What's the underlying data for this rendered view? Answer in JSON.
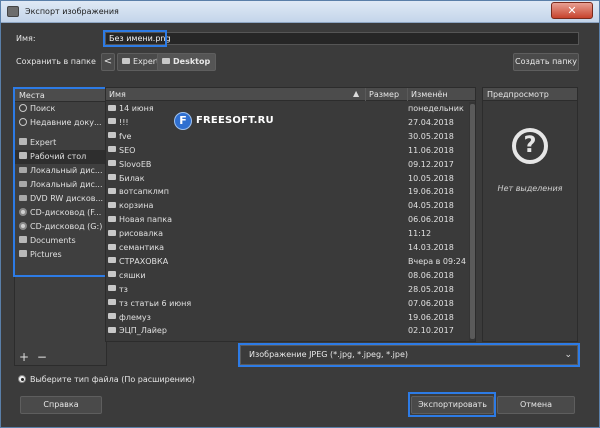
{
  "window": {
    "title": "Экспорт изображения",
    "close_glyph": "✕"
  },
  "name_label": "Имя:",
  "name_value": "Без имени.png",
  "folder_label": "Сохранить в папке",
  "breadcrumb": {
    "back_glyph": "<",
    "items": [
      "Expert",
      "Desktop"
    ]
  },
  "create_folder_label": "Создать папку",
  "places": {
    "header": "Места",
    "items": [
      {
        "label": "Поиск",
        "icon": "search-icon"
      },
      {
        "label": "Недавние доку...",
        "icon": "clock-icon"
      },
      {
        "label": "Expert",
        "icon": "folder-icon"
      },
      {
        "label": "Рабочий стол",
        "icon": "folder-icon"
      },
      {
        "label": "Локальный дис...",
        "icon": "drive-icon"
      },
      {
        "label": "Локальный дис...",
        "icon": "drive-icon"
      },
      {
        "label": "DVD RW дисков...",
        "icon": "drive-icon"
      },
      {
        "label": "CD-дисковод (F...",
        "icon": "disc-icon"
      },
      {
        "label": "CD-дисковод (G:)",
        "icon": "disc-icon"
      },
      {
        "label": "Documents",
        "icon": "folder-icon"
      },
      {
        "label": "Pictures",
        "icon": "folder-icon"
      }
    ],
    "add_glyph": "+",
    "remove_glyph": "−"
  },
  "files": {
    "columns": {
      "name": "Имя",
      "size": "Размер",
      "modified": "Изменён"
    },
    "sort_glyph": "▲",
    "rows": [
      {
        "name": "14 июня",
        "modified": "понедельник"
      },
      {
        "name": "!!!",
        "modified": "27.04.2018"
      },
      {
        "name": "fve",
        "modified": "30.05.2018"
      },
      {
        "name": "SEO",
        "modified": "11.06.2018"
      },
      {
        "name": "SlovoEB",
        "modified": "09.12.2017"
      },
      {
        "name": "Билак",
        "modified": "10.05.2018"
      },
      {
        "name": "вотсапклмп",
        "modified": "19.06.2018"
      },
      {
        "name": "корзина",
        "modified": "04.05.2018"
      },
      {
        "name": "Новая папка",
        "modified": "06.06.2018"
      },
      {
        "name": "рисовалка",
        "modified": "11:12"
      },
      {
        "name": "семантика",
        "modified": "14.03.2018"
      },
      {
        "name": "СТРАХОВКА",
        "modified": "Вчера в 09:24"
      },
      {
        "name": "сяшки",
        "modified": "08.06.2018"
      },
      {
        "name": "тз",
        "modified": "28.05.2018"
      },
      {
        "name": "тз статьи 6 июня",
        "modified": "07.06.2018"
      },
      {
        "name": "флемуз",
        "modified": "19.06.2018"
      },
      {
        "name": "ЭЦП_Лайер",
        "modified": "02.10.2017"
      }
    ]
  },
  "watermark": {
    "glyph": "F",
    "text": "FREESOFT.RU"
  },
  "preview": {
    "header": "Предпросмотр",
    "glyph": "?",
    "empty_text": "Нет выделения"
  },
  "filetype": {
    "value": "Изображение JPEG (*.jpg, *.jpeg, *.jpe)",
    "chevron": "⌄"
  },
  "type_option": "Выберите тип файла (По расширению)",
  "buttons": {
    "help": "Справка",
    "export": "Экспортировать",
    "cancel": "Отмена"
  },
  "accent_color": "#2d7be5"
}
